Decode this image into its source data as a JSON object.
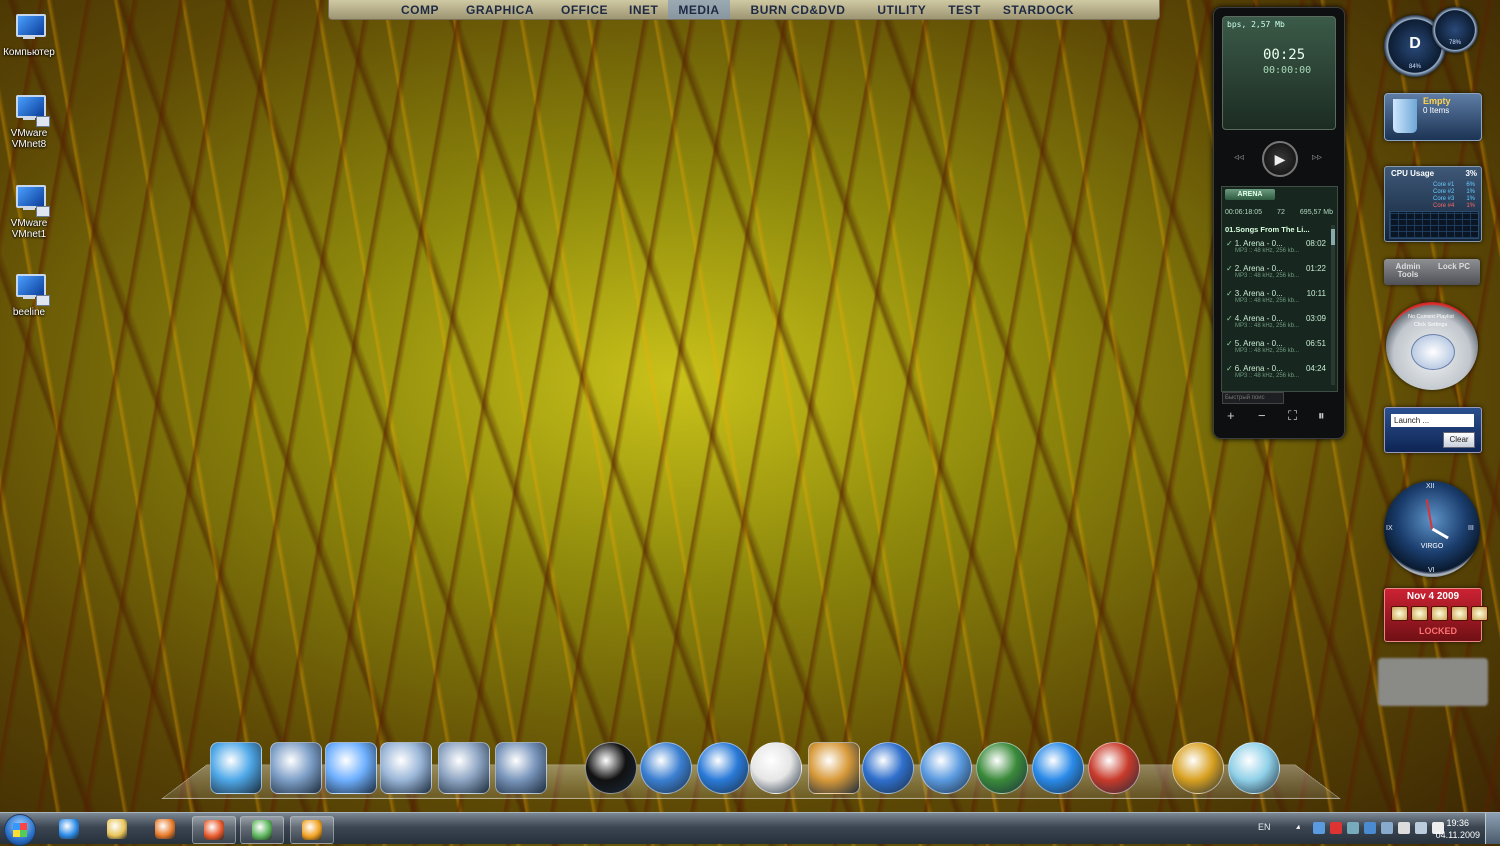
{
  "desktop_icons": [
    {
      "label": "Компьютер"
    },
    {
      "label": "VMware VMnet8"
    },
    {
      "label": "VMware VMnet1"
    },
    {
      "label": "beeline"
    }
  ],
  "top_menu": {
    "items": [
      "COMP",
      "GRAPHICA",
      "OFFICE",
      "INET",
      "MEDIA",
      "BURN CD&DVD",
      "UTILITY",
      "TEST",
      "STARDOCK"
    ],
    "active": "MEDIA"
  },
  "player": {
    "bitrate": "bps, 2,57 Mb",
    "time": "00:25",
    "time_sub": "00:00:00",
    "play": "▶",
    "rewind": "◃◃",
    "forward": "▹▹",
    "playlist_name": "ARENA",
    "total_time": "00:06:18:05",
    "count": "72",
    "size": "695,57 Mb",
    "album": "01.Songs From The Li...",
    "tracks": [
      {
        "title": "1. Arena - 0...",
        "duration": "08:02",
        "format": "MP3 :: 48 kHz, 256 kb..."
      },
      {
        "title": "2. Arena - 0...",
        "duration": "01:22",
        "format": "MP3 :: 48 kHz, 256 kb..."
      },
      {
        "title": "3. Arena - 0...",
        "duration": "10:11",
        "format": "MP3 :: 48 kHz, 256 kb..."
      },
      {
        "title": "4. Arena - 0...",
        "duration": "03:09",
        "format": "MP3 :: 48 kHz, 256 kb..."
      },
      {
        "title": "5. Arena - 0...",
        "duration": "06:51",
        "format": "MP3 :: 48 kHz, 256 kb..."
      },
      {
        "title": "6. Arena - 0...",
        "duration": "04:24",
        "format": "MP3 :: 48 kHz, 256 kb..."
      }
    ],
    "search_placeholder": "Быстрый поис",
    "add": "+",
    "remove": "−",
    "select": "⛶",
    "pause": "⏸"
  },
  "gadgets": {
    "speedo_letter": "D",
    "speedo_pct": "84%",
    "speedo2_pct": "78%",
    "recycle_title": "Empty",
    "recycle_items": "0 Items",
    "cpu_title": "CPU Usage",
    "cpu_total": "3%",
    "cores": [
      {
        "name": "Core #1",
        "value": "6%",
        "color": "#66ccff"
      },
      {
        "name": "Core #2",
        "value": "1%",
        "color": "#66ccff"
      },
      {
        "name": "Core #3",
        "value": "1%",
        "color": "#66ccff"
      },
      {
        "name": "Core #4",
        "value": "1%",
        "color": "#ff6666"
      }
    ],
    "admin_tools": "Admin Tools",
    "lock_pc": "Lock PC",
    "media_line1": "No Current Playlist",
    "media_line2": "Click Settings",
    "launch_value": "Launch ...",
    "clear_button": "Clear",
    "clock_numerals": [
      "XII",
      "III",
      "VI",
      "IX"
    ],
    "clock_sign": "VIRGO",
    "calendar_date": "Nov 4 2009",
    "locked": "LOCKED"
  },
  "dock_items": [
    {
      "name": "monitor-icon",
      "color": "#4fa8e8"
    },
    {
      "name": "control-panel-icon",
      "color": "#7fa0c8"
    },
    {
      "name": "documents-icon",
      "color": "#6fb0ff"
    },
    {
      "name": "search-icon",
      "color": "#9ab6d8"
    },
    {
      "name": "camera-icon",
      "color": "#8fa6c4"
    },
    {
      "name": "3d-file-icon",
      "color": "#7a96bc"
    },
    {
      "name": "utorrent-icon",
      "color": "#111111"
    },
    {
      "name": "flower-icon",
      "color": "#3b7fd1"
    },
    {
      "name": "tools-icon",
      "color": "#2a7ad8"
    },
    {
      "name": "dvd-burn-icon",
      "color": "#e6e6e6"
    },
    {
      "name": "frame-icon",
      "color": "#d89a3a"
    },
    {
      "name": "media-player-icon",
      "color": "#2f6fcc"
    },
    {
      "name": "disc-edit-icon",
      "color": "#5a9ae0"
    },
    {
      "name": "windows-logo-icon",
      "color": "#3a8a3a"
    },
    {
      "name": "internet-explorer-icon",
      "color": "#2a8ae8"
    },
    {
      "name": "spider-icon",
      "color": "#c83a2a"
    },
    {
      "name": "r-logo-icon",
      "color": "#d8a020"
    },
    {
      "name": "recycle-bin-icon",
      "color": "#8fd0e8"
    }
  ],
  "taskbar": {
    "items": [
      {
        "name": "internet-explorer-icon",
        "color": "#2a8ae8",
        "active": false
      },
      {
        "name": "explorer-folder-icon",
        "color": "#e8c45a",
        "active": false
      },
      {
        "name": "media-player-icon",
        "color": "#e87a2a",
        "active": false
      },
      {
        "name": "firefox-icon",
        "color": "#e8582a",
        "active": true
      },
      {
        "name": "network-icon",
        "color": "#5ab45a",
        "active": true
      },
      {
        "name": "aimp-icon",
        "color": "#f0a020",
        "active": true
      }
    ],
    "lang": "EN",
    "time": "19:36",
    "date": "04.11.2009"
  }
}
